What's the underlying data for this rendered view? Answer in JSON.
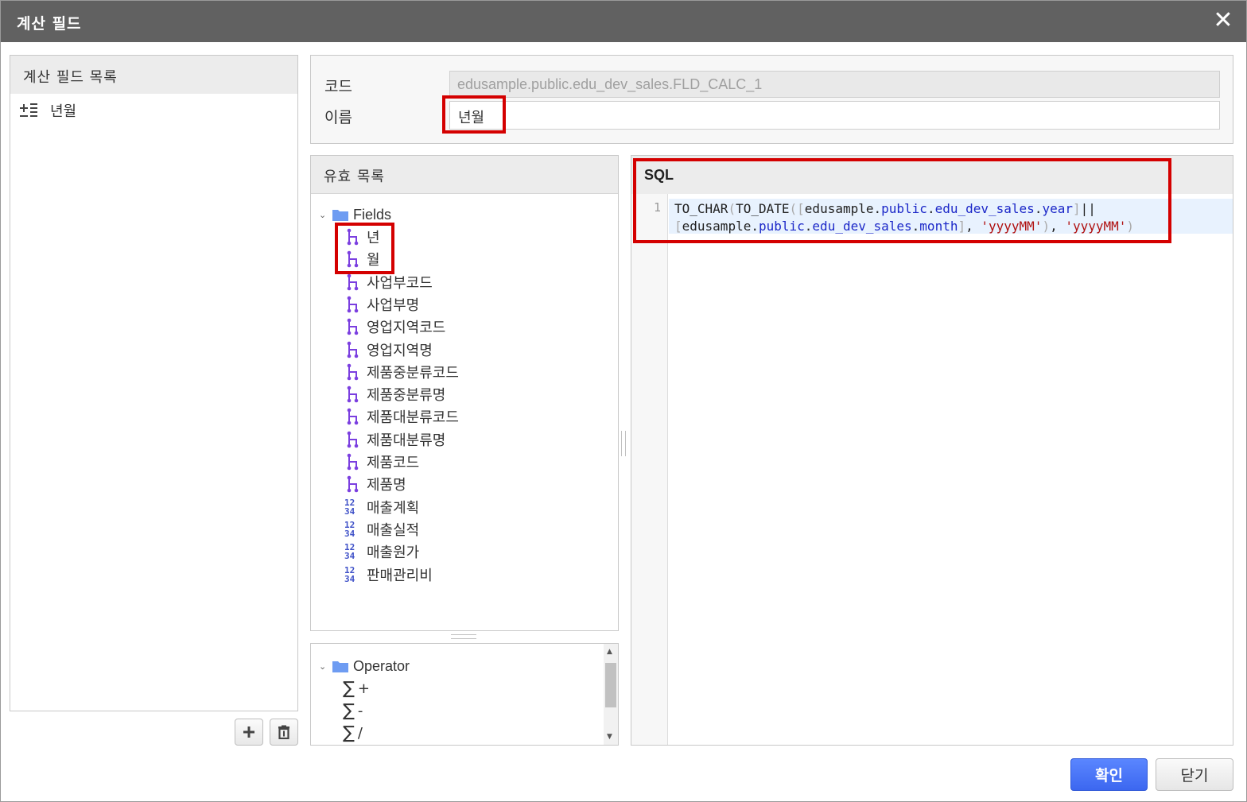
{
  "dialog": {
    "title": "계산 필드",
    "close_symbol": "✕"
  },
  "left_panel": {
    "header": "계산 필드 목록",
    "items": [
      {
        "label": "년월",
        "icon": "calculated-field-icon"
      }
    ],
    "add_icon": "plus-icon",
    "delete_icon": "trash-icon"
  },
  "info": {
    "code_label": "코드",
    "code_value": "edusample.public.edu_dev_sales.FLD_CALC_1",
    "name_label": "이름",
    "name_value": "년월"
  },
  "valid_list": {
    "header": "유효 목록",
    "root_label": "Fields",
    "items": [
      {
        "label": "년",
        "icon": "dimension-icon"
      },
      {
        "label": "월",
        "icon": "dimension-icon"
      },
      {
        "label": "사업부코드",
        "icon": "dimension-icon"
      },
      {
        "label": "사업부명",
        "icon": "dimension-icon"
      },
      {
        "label": "영업지역코드",
        "icon": "dimension-icon"
      },
      {
        "label": "영업지역명",
        "icon": "dimension-icon"
      },
      {
        "label": "제품중분류코드",
        "icon": "dimension-icon"
      },
      {
        "label": "제품중분류명",
        "icon": "dimension-icon"
      },
      {
        "label": "제품대분류코드",
        "icon": "dimension-icon"
      },
      {
        "label": "제품대분류명",
        "icon": "dimension-icon"
      },
      {
        "label": "제품코드",
        "icon": "dimension-icon"
      },
      {
        "label": "제품명",
        "icon": "dimension-icon"
      },
      {
        "label": "매출계획",
        "icon": "measure-icon"
      },
      {
        "label": "매출실적",
        "icon": "measure-icon"
      },
      {
        "label": "매출원가",
        "icon": "measure-icon"
      },
      {
        "label": "판매관리비",
        "icon": "measure-icon"
      }
    ],
    "measure_icon_text": {
      "top": "12",
      "bottom": "34"
    }
  },
  "operator": {
    "root_label": "Operator",
    "sigma": "∑",
    "items": [
      {
        "label": "+"
      },
      {
        "label": "-"
      },
      {
        "label": "/"
      }
    ]
  },
  "sql": {
    "header": "SQL",
    "line_number": "1",
    "tokens_line1": {
      "fn1": "TO_CHAR",
      "p1": "(",
      "fn2": "TO_DATE",
      "p2": "(",
      "b1": "[",
      "db": "edusample",
      "d1": ".",
      "schema": "public",
      "d2": ".",
      "table": "edu_dev_sales",
      "d3": ".",
      "col": "year",
      "b2": "]",
      "op": "||"
    },
    "tokens_line2": {
      "b1": "[",
      "db": "edusample",
      "d1": ".",
      "schema": "public",
      "d2": ".",
      "table": "edu_dev_sales",
      "d3": ".",
      "col": "month",
      "b2": "]",
      "comma1": ", ",
      "str1": "'yyyyMM'",
      "p1": ")",
      "comma2": ", ",
      "str2": "'yyyyMM'",
      "p2": ")"
    }
  },
  "buttons": {
    "ok": "확인",
    "close": "닫기"
  },
  "colors": {
    "highlight": "#d40000",
    "primary": "#3c67f0",
    "titlebar": "#616161"
  }
}
